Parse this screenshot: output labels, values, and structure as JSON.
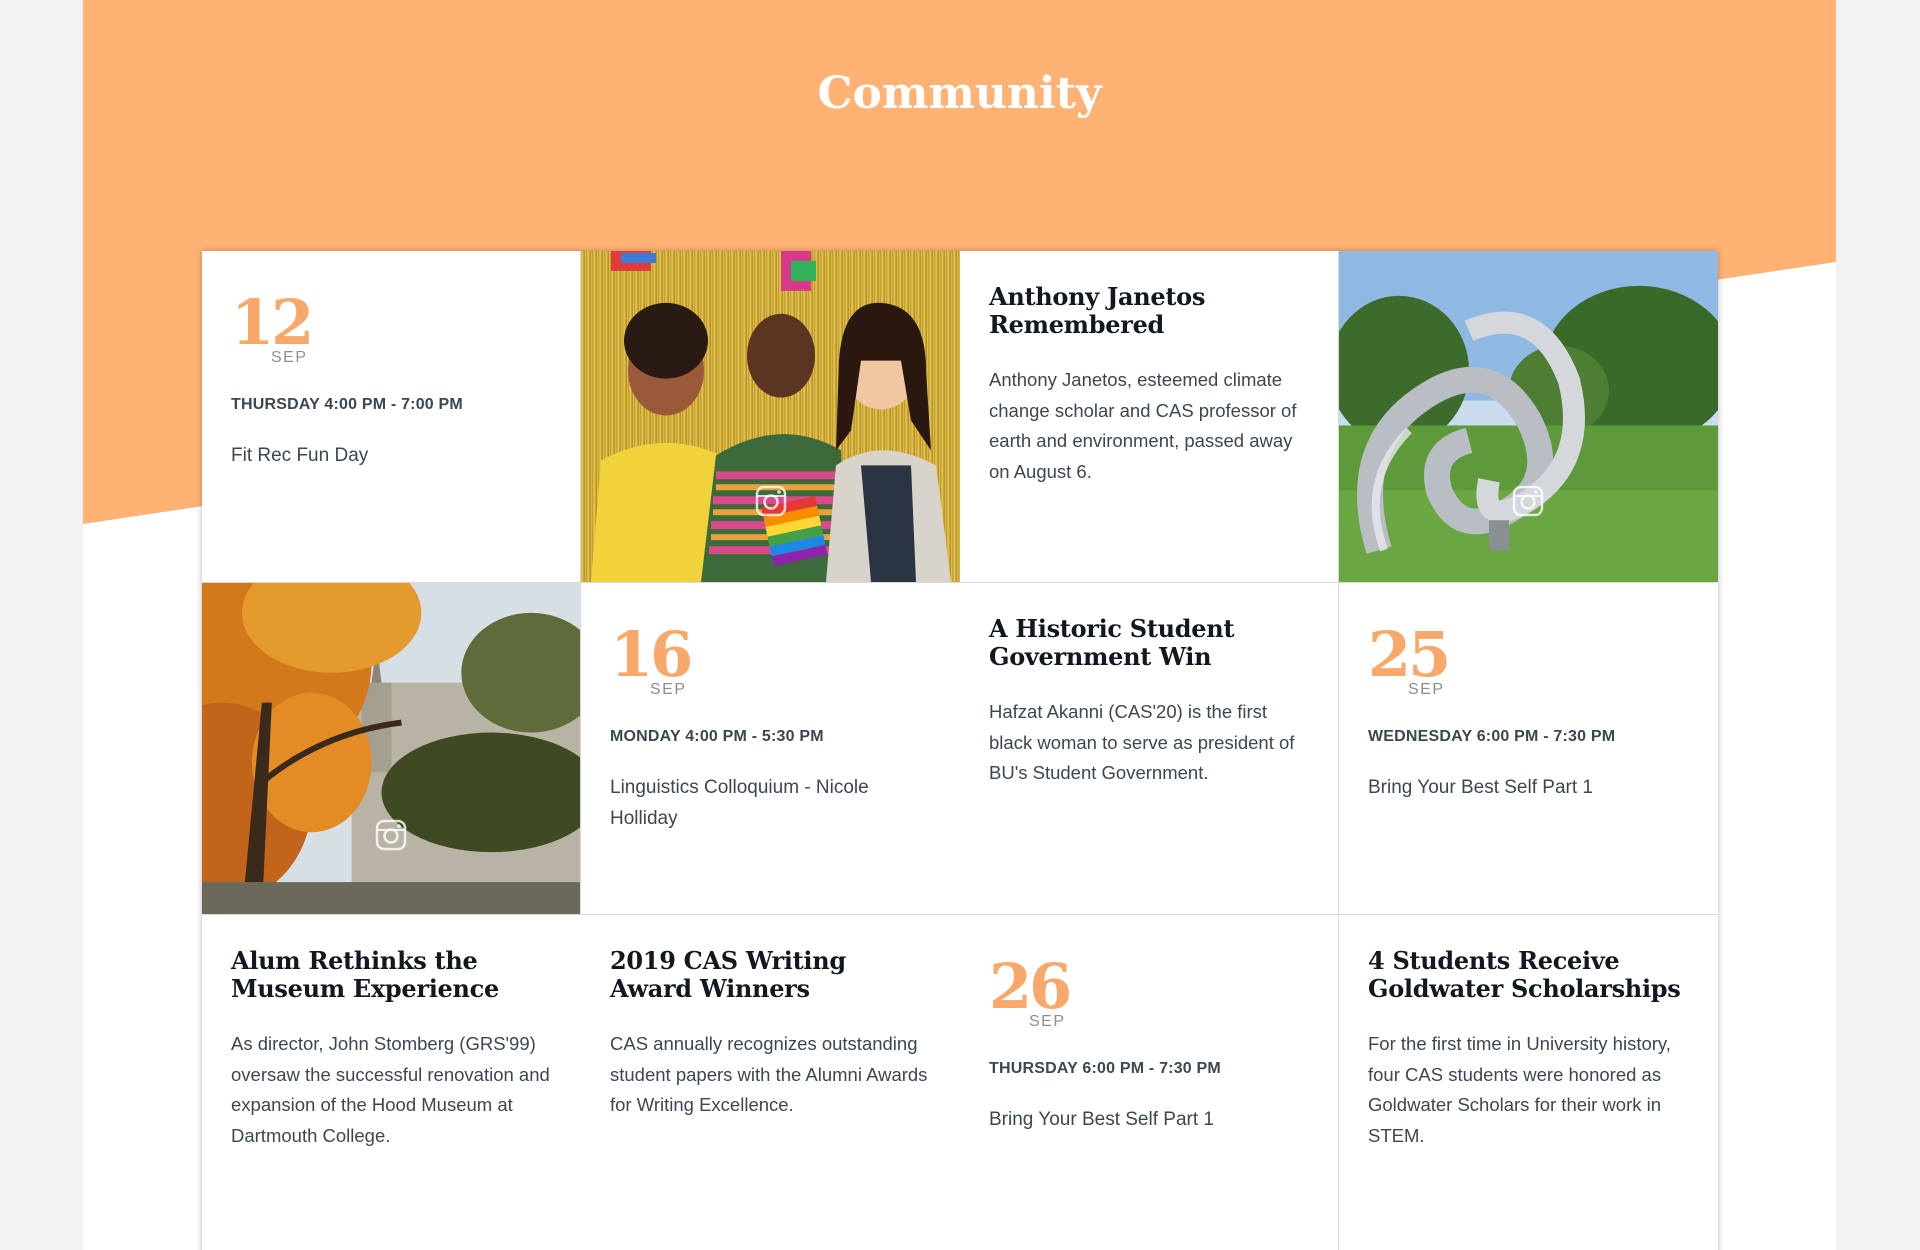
{
  "section": {
    "title": "Community"
  },
  "colors": {
    "accent": "#FEB273",
    "date": "#F8A86A",
    "heading": "#111820",
    "text": "#3B4751"
  },
  "photos": [
    {
      "subject": "students-with-rainbow-flag",
      "icon": "instagram-icon"
    },
    {
      "subject": "mobius-sculpture-on-lawn",
      "icon": "instagram-icon"
    },
    {
      "subject": "autumn-campus-building",
      "icon": "instagram-icon"
    }
  ],
  "events": [
    {
      "day": "12",
      "month": "SEP",
      "when": "THURSDAY 4:00 PM - 7:00 PM",
      "title": "Fit Rec Fun Day"
    },
    {
      "day": "16",
      "month": "SEP",
      "when": "MONDAY 4:00 PM - 5:30 PM",
      "title": "Linguistics Colloquium - Nicole Holliday"
    },
    {
      "day": "25",
      "month": "SEP",
      "when": "WEDNESDAY 6:00 PM - 7:30 PM",
      "title": "Bring Your Best Self Part 1"
    },
    {
      "day": "26",
      "month": "SEP",
      "when": "THURSDAY 6:00 PM - 7:30 PM",
      "title": "Bring Your Best Self Part 1"
    }
  ],
  "stories": [
    {
      "title": "Anthony Janetos Remembered",
      "text": "Anthony Janetos, esteemed climate change scholar and CAS professor of earth and environment, passed away on August 6."
    },
    {
      "title": "A Historic Student Government Win",
      "text": "Hafzat Akanni (CAS'20) is the first black woman to serve as president of BU's Student Government."
    },
    {
      "title": "Alum Rethinks the Museum Experience",
      "text": "As director, John Stomberg (GRS'99) oversaw the successful renovation and expansion of the Hood Museum at Dartmouth College."
    },
    {
      "title": "2019 CAS Writing Award Winners",
      "text": "CAS annually recognizes outstanding student papers with the Alumni Awards for Writing Excellence."
    },
    {
      "title": "4 Students Receive Goldwater Scholarships",
      "text": "For the first time in University history, four CAS students were honored as Goldwater Scholars for their work in STEM."
    }
  ]
}
